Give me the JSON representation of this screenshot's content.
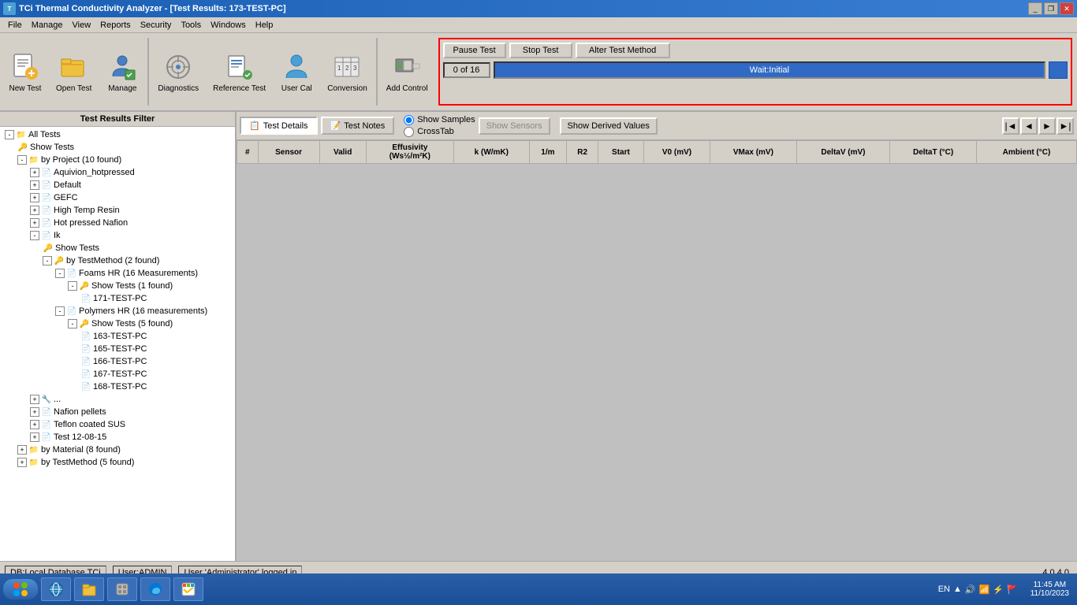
{
  "window": {
    "title": "TCi Thermal Conductivity Analyzer - [Test Results: 173-TEST-PC]",
    "version": "4.0.4.0"
  },
  "menu": {
    "items": [
      "File",
      "Manage",
      "View",
      "Reports",
      "Security",
      "Tools",
      "Windows",
      "Help"
    ]
  },
  "toolbar": {
    "buttons": [
      {
        "label": "New Test",
        "icon": "new-test"
      },
      {
        "label": "Open Test",
        "icon": "open-test"
      },
      {
        "label": "Manage",
        "icon": "manage"
      },
      {
        "label": "Diagnostics",
        "icon": "diagnostics"
      },
      {
        "label": "Reference Test",
        "icon": "reference-test"
      },
      {
        "label": "User Cal",
        "icon": "user-cal"
      },
      {
        "label": "Conversion",
        "icon": "conversion"
      },
      {
        "label": "Add Control",
        "icon": "add-control"
      }
    ]
  },
  "test_controls": {
    "pause_label": "Pause Test",
    "stop_label": "Stop Test",
    "alter_label": "Alter Test Method",
    "progress_count": "0 of 16",
    "status_text": "Wait:Initial"
  },
  "filter_panel": {
    "title": "Test Results Filter",
    "tree": [
      {
        "level": 0,
        "type": "root",
        "label": "All Tests",
        "expanded": true
      },
      {
        "level": 1,
        "type": "folder",
        "label": "Show Tests",
        "expanded": false
      },
      {
        "level": 1,
        "type": "folder",
        "label": "by Project (10 found)",
        "expanded": true
      },
      {
        "level": 2,
        "type": "item",
        "label": "Aquivion_hotpressed"
      },
      {
        "level": 2,
        "type": "item",
        "label": "Default"
      },
      {
        "level": 2,
        "type": "item",
        "label": "GEFC"
      },
      {
        "level": 2,
        "type": "item",
        "label": "High Temp Resin"
      },
      {
        "level": 2,
        "type": "item",
        "label": "Hot pressed Nafion"
      },
      {
        "level": 2,
        "type": "folder",
        "label": "Ik",
        "expanded": true
      },
      {
        "level": 3,
        "type": "item",
        "label": "Show Tests"
      },
      {
        "level": 3,
        "type": "folder",
        "label": "by TestMethod (2 found)",
        "expanded": true
      },
      {
        "level": 4,
        "type": "folder",
        "label": "Foams HR (16 Measurements)",
        "expanded": true
      },
      {
        "level": 5,
        "type": "folder",
        "label": "Show Tests (1 found)",
        "expanded": true
      },
      {
        "level": 6,
        "type": "item",
        "label": "171-TEST-PC"
      },
      {
        "level": 4,
        "type": "folder",
        "label": "Polymers HR (16 measurements)",
        "expanded": true
      },
      {
        "level": 5,
        "type": "folder",
        "label": "Show Tests (5 found)",
        "expanded": true
      },
      {
        "level": 6,
        "type": "item",
        "label": "163-TEST-PC"
      },
      {
        "level": 6,
        "type": "item",
        "label": "165-TEST-PC"
      },
      {
        "level": 6,
        "type": "item",
        "label": "166-TEST-PC"
      },
      {
        "level": 6,
        "type": "item",
        "label": "167-TEST-PC"
      },
      {
        "level": 6,
        "type": "item",
        "label": "168-TEST-PC"
      },
      {
        "level": 2,
        "type": "item",
        "label": "..."
      },
      {
        "level": 2,
        "type": "item",
        "label": "Nafion pellets"
      },
      {
        "level": 2,
        "type": "item",
        "label": "Teflon coated SUS"
      },
      {
        "level": 2,
        "type": "item",
        "label": "Test 12-08-15"
      },
      {
        "level": 1,
        "type": "folder",
        "label": "by Material (8 found)",
        "expanded": false
      },
      {
        "level": 1,
        "type": "folder",
        "label": "by TestMethod (5 found)",
        "expanded": false
      }
    ]
  },
  "results_panel": {
    "tabs": [
      {
        "label": "Test Details",
        "active": true
      },
      {
        "label": "Test Notes",
        "active": false
      }
    ],
    "radio_options": [
      {
        "label": "Show Samples",
        "selected": true
      },
      {
        "label": "CrossTab",
        "selected": false
      }
    ],
    "sensors_btn": "Show Sensors",
    "derived_btn": "Show Derived Values",
    "nav_btns": [
      "|◄",
      "◄",
      "►",
      "►|"
    ],
    "table_headers": [
      "#",
      "Sensor",
      "Valid",
      "Effusivity (Ws½/m²K)",
      "k (W/mK)",
      "1/m",
      "R2",
      "Start",
      "V0 (mV)",
      "VMax (mV)",
      "DeltaV (mV)",
      "DeltaT (°C)",
      "Ambient (°C)"
    ]
  },
  "status_bar": {
    "db": "DB:Local Database TCi",
    "user": "User:ADMIN",
    "logged_in": "User 'Administrator' logged in"
  },
  "taskbar": {
    "time": "11:45 AM",
    "date": "11/10/2023",
    "locale": "EN"
  }
}
